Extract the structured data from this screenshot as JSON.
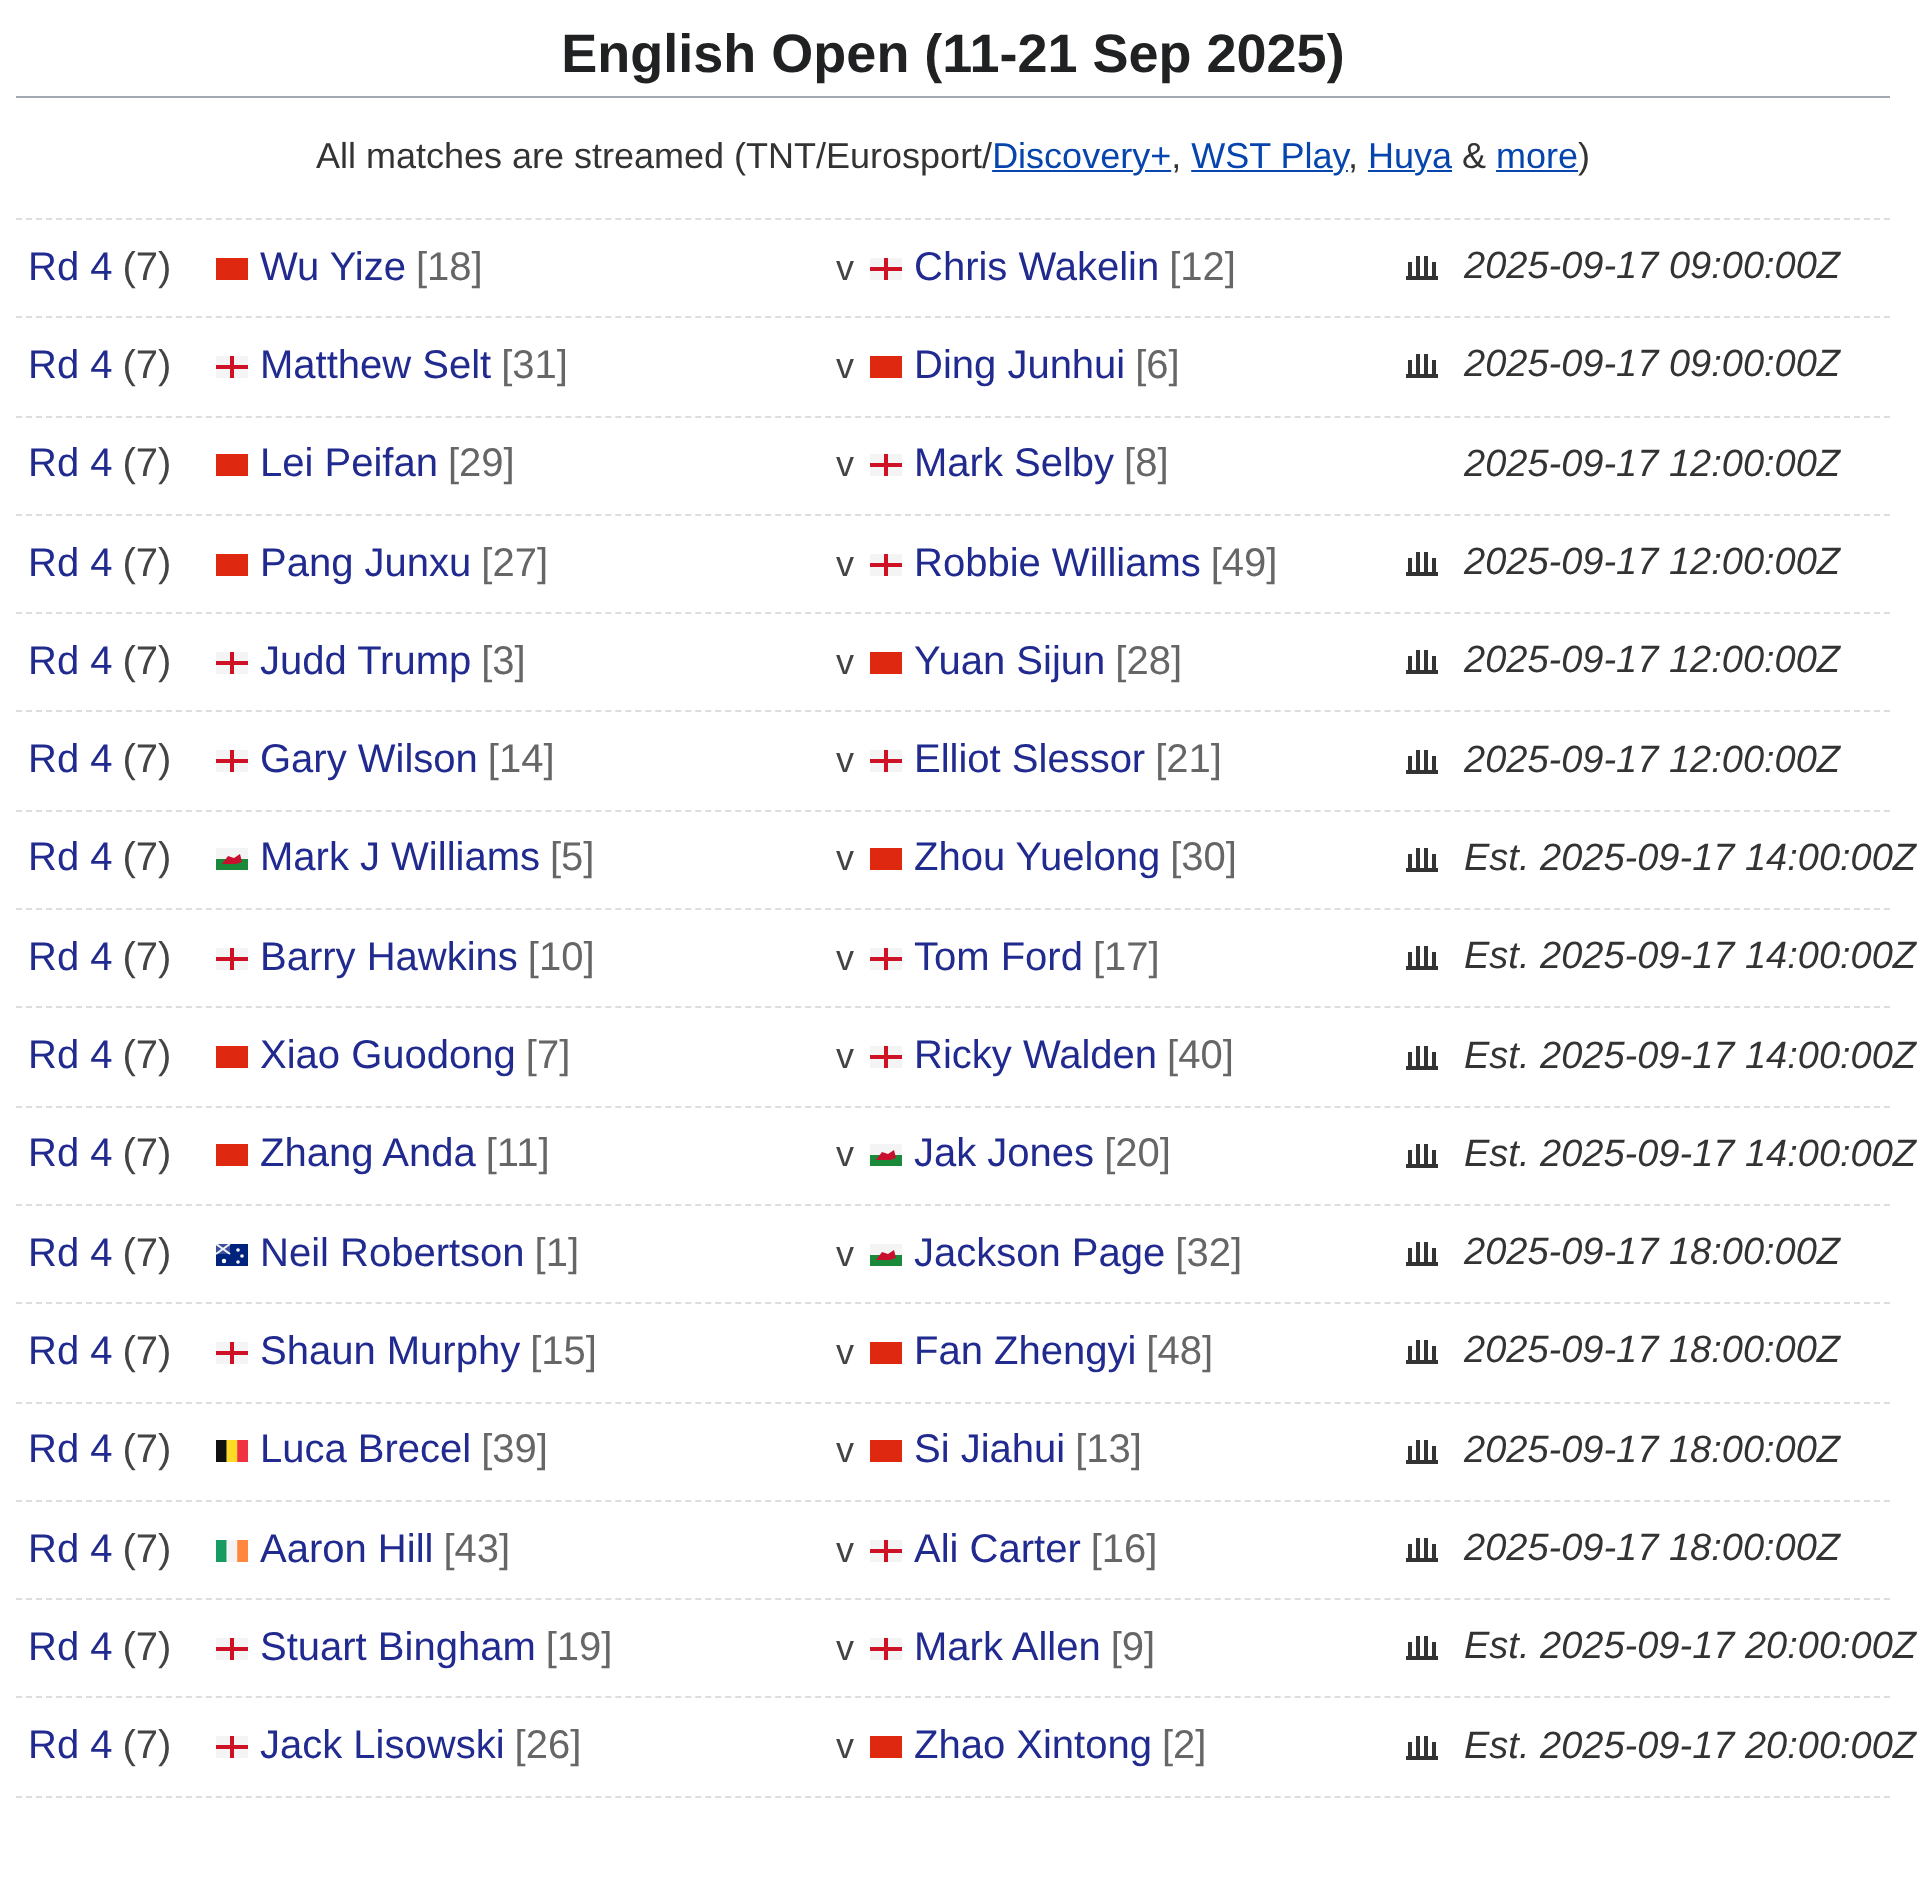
{
  "title": "English Open (11-21 Sep 2025)",
  "streams_note": [
    {
      "text": "All matches are streamed (TNT/Eurosport/",
      "link": false
    },
    {
      "text": "Discovery+",
      "link": true
    },
    {
      "text": ", ",
      "link": false
    },
    {
      "text": "WST Play",
      "link": true
    },
    {
      "text": ", ",
      "link": false
    },
    {
      "text": "Huya",
      "link": true
    },
    {
      "text": " & ",
      "link": false
    },
    {
      "text": "more",
      "link": true
    },
    {
      "text": ")",
      "link": false
    }
  ],
  "matches": [
    {
      "round": "Rd 4",
      "frames": "(7)",
      "player1": {
        "kind": "chn",
        "name": "Wu Yize",
        "seed": "[18]"
      },
      "vs": "v",
      "player2": {
        "kind": "eng",
        "name": "Chris Wakelin",
        "seed": "[12]"
      },
      "streamed": true,
      "time": "2025-09-17 09:00:00Z"
    },
    {
      "round": "Rd 4",
      "frames": "(7)",
      "player1": {
        "kind": "eng",
        "name": "Matthew Selt",
        "seed": "[31]"
      },
      "vs": "v",
      "player2": {
        "kind": "chn",
        "name": "Ding Junhui",
        "seed": "[6]"
      },
      "streamed": true,
      "time": "2025-09-17 09:00:00Z"
    },
    {
      "round": "Rd 4",
      "frames": "(7)",
      "player1": {
        "kind": "chn",
        "name": "Lei Peifan",
        "seed": "[29]"
      },
      "vs": "v",
      "player2": {
        "kind": "eng",
        "name": "Mark Selby",
        "seed": "[8]"
      },
      "streamed": false,
      "time": "2025-09-17 12:00:00Z"
    },
    {
      "round": "Rd 4",
      "frames": "(7)",
      "player1": {
        "kind": "chn",
        "name": "Pang Junxu",
        "seed": "[27]"
      },
      "vs": "v",
      "player2": {
        "kind": "eng",
        "name": "Robbie Williams",
        "seed": "[49]"
      },
      "streamed": true,
      "time": "2025-09-17 12:00:00Z"
    },
    {
      "round": "Rd 4",
      "frames": "(7)",
      "player1": {
        "kind": "eng",
        "name": "Judd Trump",
        "seed": "[3]"
      },
      "vs": "v",
      "player2": {
        "kind": "chn",
        "name": "Yuan Sijun",
        "seed": "[28]"
      },
      "streamed": true,
      "time": "2025-09-17 12:00:00Z"
    },
    {
      "round": "Rd 4",
      "frames": "(7)",
      "player1": {
        "kind": "eng",
        "name": "Gary Wilson",
        "seed": "[14]"
      },
      "vs": "v",
      "player2": {
        "kind": "eng",
        "name": "Elliot Slessor",
        "seed": "[21]"
      },
      "streamed": true,
      "time": "2025-09-17 12:00:00Z"
    },
    {
      "round": "Rd 4",
      "frames": "(7)",
      "player1": {
        "kind": "wal",
        "name": "Mark J Williams",
        "seed": "[5]"
      },
      "vs": "v",
      "player2": {
        "kind": "chn",
        "name": "Zhou Yuelong",
        "seed": "[30]"
      },
      "streamed": true,
      "time": "Est. 2025-09-17 14:00:00Z"
    },
    {
      "round": "Rd 4",
      "frames": "(7)",
      "player1": {
        "kind": "eng",
        "name": "Barry Hawkins",
        "seed": "[10]"
      },
      "vs": "v",
      "player2": {
        "kind": "eng",
        "name": "Tom Ford",
        "seed": "[17]"
      },
      "streamed": true,
      "time": "Est. 2025-09-17 14:00:00Z"
    },
    {
      "round": "Rd 4",
      "frames": "(7)",
      "player1": {
        "kind": "chn",
        "name": "Xiao Guodong",
        "seed": "[7]"
      },
      "vs": "v",
      "player2": {
        "kind": "eng",
        "name": "Ricky Walden",
        "seed": "[40]"
      },
      "streamed": true,
      "time": "Est. 2025-09-17 14:00:00Z"
    },
    {
      "round": "Rd 4",
      "frames": "(7)",
      "player1": {
        "kind": "chn",
        "name": "Zhang Anda",
        "seed": "[11]"
      },
      "vs": "v",
      "player2": {
        "kind": "wal",
        "name": "Jak Jones",
        "seed": "[20]"
      },
      "streamed": true,
      "time": "Est. 2025-09-17 14:00:00Z"
    },
    {
      "round": "Rd 4",
      "frames": "(7)",
      "player1": {
        "kind": "aus",
        "name": "Neil Robertson",
        "seed": "[1]"
      },
      "vs": "v",
      "player2": {
        "kind": "wal",
        "name": "Jackson Page",
        "seed": "[32]"
      },
      "streamed": true,
      "time": "2025-09-17 18:00:00Z"
    },
    {
      "round": "Rd 4",
      "frames": "(7)",
      "player1": {
        "kind": "eng",
        "name": "Shaun Murphy",
        "seed": "[15]"
      },
      "vs": "v",
      "player2": {
        "kind": "chn",
        "name": "Fan Zhengyi",
        "seed": "[48]"
      },
      "streamed": true,
      "time": "2025-09-17 18:00:00Z"
    },
    {
      "round": "Rd 4",
      "frames": "(7)",
      "player1": {
        "kind": "bel",
        "name": "Luca Brecel",
        "seed": "[39]"
      },
      "vs": "v",
      "player2": {
        "kind": "chn",
        "name": "Si Jiahui",
        "seed": "[13]"
      },
      "streamed": true,
      "time": "2025-09-17 18:00:00Z"
    },
    {
      "round": "Rd 4",
      "frames": "(7)",
      "player1": {
        "kind": "irl",
        "name": "Aaron Hill",
        "seed": "[43]"
      },
      "vs": "v",
      "player2": {
        "kind": "eng",
        "name": "Ali Carter",
        "seed": "[16]"
      },
      "streamed": true,
      "time": "2025-09-17 18:00:00Z"
    },
    {
      "round": "Rd 4",
      "frames": "(7)",
      "player1": {
        "kind": "eng",
        "name": "Stuart Bingham",
        "seed": "[19]"
      },
      "vs": "v",
      "player2": {
        "kind": "eng",
        "name": "Mark Allen",
        "seed": "[9]"
      },
      "streamed": true,
      "time": "Est. 2025-09-17 20:00:00Z"
    },
    {
      "round": "Rd 4",
      "frames": "(7)",
      "player1": {
        "kind": "eng",
        "name": "Jack Lisowski",
        "seed": "[26]"
      },
      "vs": "v",
      "player2": {
        "kind": "chn",
        "name": "Zhao Xintong",
        "seed": "[2]"
      },
      "streamed": true,
      "time": "Est. 2025-09-17 20:00:00Z"
    }
  ]
}
